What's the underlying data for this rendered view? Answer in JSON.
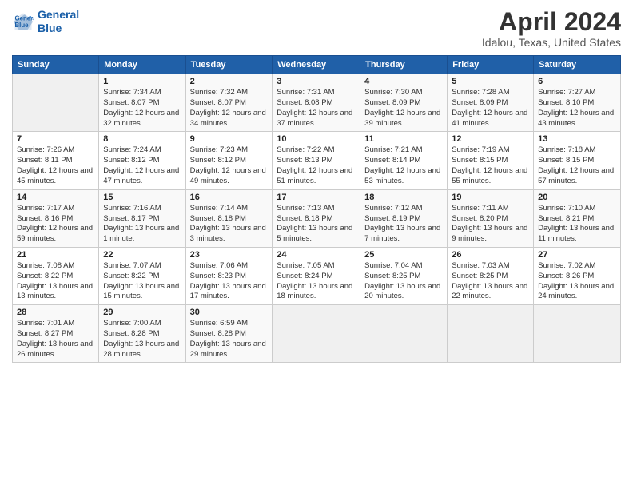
{
  "header": {
    "logo_line1": "General",
    "logo_line2": "Blue",
    "month": "April 2024",
    "location": "Idalou, Texas, United States"
  },
  "weekdays": [
    "Sunday",
    "Monday",
    "Tuesday",
    "Wednesday",
    "Thursday",
    "Friday",
    "Saturday"
  ],
  "weeks": [
    [
      {
        "day": "",
        "sunrise": "",
        "sunset": "",
        "daylight": ""
      },
      {
        "day": "1",
        "sunrise": "Sunrise: 7:34 AM",
        "sunset": "Sunset: 8:07 PM",
        "daylight": "Daylight: 12 hours and 32 minutes."
      },
      {
        "day": "2",
        "sunrise": "Sunrise: 7:32 AM",
        "sunset": "Sunset: 8:07 PM",
        "daylight": "Daylight: 12 hours and 34 minutes."
      },
      {
        "day": "3",
        "sunrise": "Sunrise: 7:31 AM",
        "sunset": "Sunset: 8:08 PM",
        "daylight": "Daylight: 12 hours and 37 minutes."
      },
      {
        "day": "4",
        "sunrise": "Sunrise: 7:30 AM",
        "sunset": "Sunset: 8:09 PM",
        "daylight": "Daylight: 12 hours and 39 minutes."
      },
      {
        "day": "5",
        "sunrise": "Sunrise: 7:28 AM",
        "sunset": "Sunset: 8:09 PM",
        "daylight": "Daylight: 12 hours and 41 minutes."
      },
      {
        "day": "6",
        "sunrise": "Sunrise: 7:27 AM",
        "sunset": "Sunset: 8:10 PM",
        "daylight": "Daylight: 12 hours and 43 minutes."
      }
    ],
    [
      {
        "day": "7",
        "sunrise": "Sunrise: 7:26 AM",
        "sunset": "Sunset: 8:11 PM",
        "daylight": "Daylight: 12 hours and 45 minutes."
      },
      {
        "day": "8",
        "sunrise": "Sunrise: 7:24 AM",
        "sunset": "Sunset: 8:12 PM",
        "daylight": "Daylight: 12 hours and 47 minutes."
      },
      {
        "day": "9",
        "sunrise": "Sunrise: 7:23 AM",
        "sunset": "Sunset: 8:12 PM",
        "daylight": "Daylight: 12 hours and 49 minutes."
      },
      {
        "day": "10",
        "sunrise": "Sunrise: 7:22 AM",
        "sunset": "Sunset: 8:13 PM",
        "daylight": "Daylight: 12 hours and 51 minutes."
      },
      {
        "day": "11",
        "sunrise": "Sunrise: 7:21 AM",
        "sunset": "Sunset: 8:14 PM",
        "daylight": "Daylight: 12 hours and 53 minutes."
      },
      {
        "day": "12",
        "sunrise": "Sunrise: 7:19 AM",
        "sunset": "Sunset: 8:15 PM",
        "daylight": "Daylight: 12 hours and 55 minutes."
      },
      {
        "day": "13",
        "sunrise": "Sunrise: 7:18 AM",
        "sunset": "Sunset: 8:15 PM",
        "daylight": "Daylight: 12 hours and 57 minutes."
      }
    ],
    [
      {
        "day": "14",
        "sunrise": "Sunrise: 7:17 AM",
        "sunset": "Sunset: 8:16 PM",
        "daylight": "Daylight: 12 hours and 59 minutes."
      },
      {
        "day": "15",
        "sunrise": "Sunrise: 7:16 AM",
        "sunset": "Sunset: 8:17 PM",
        "daylight": "Daylight: 13 hours and 1 minute."
      },
      {
        "day": "16",
        "sunrise": "Sunrise: 7:14 AM",
        "sunset": "Sunset: 8:18 PM",
        "daylight": "Daylight: 13 hours and 3 minutes."
      },
      {
        "day": "17",
        "sunrise": "Sunrise: 7:13 AM",
        "sunset": "Sunset: 8:18 PM",
        "daylight": "Daylight: 13 hours and 5 minutes."
      },
      {
        "day": "18",
        "sunrise": "Sunrise: 7:12 AM",
        "sunset": "Sunset: 8:19 PM",
        "daylight": "Daylight: 13 hours and 7 minutes."
      },
      {
        "day": "19",
        "sunrise": "Sunrise: 7:11 AM",
        "sunset": "Sunset: 8:20 PM",
        "daylight": "Daylight: 13 hours and 9 minutes."
      },
      {
        "day": "20",
        "sunrise": "Sunrise: 7:10 AM",
        "sunset": "Sunset: 8:21 PM",
        "daylight": "Daylight: 13 hours and 11 minutes."
      }
    ],
    [
      {
        "day": "21",
        "sunrise": "Sunrise: 7:08 AM",
        "sunset": "Sunset: 8:22 PM",
        "daylight": "Daylight: 13 hours and 13 minutes."
      },
      {
        "day": "22",
        "sunrise": "Sunrise: 7:07 AM",
        "sunset": "Sunset: 8:22 PM",
        "daylight": "Daylight: 13 hours and 15 minutes."
      },
      {
        "day": "23",
        "sunrise": "Sunrise: 7:06 AM",
        "sunset": "Sunset: 8:23 PM",
        "daylight": "Daylight: 13 hours and 17 minutes."
      },
      {
        "day": "24",
        "sunrise": "Sunrise: 7:05 AM",
        "sunset": "Sunset: 8:24 PM",
        "daylight": "Daylight: 13 hours and 18 minutes."
      },
      {
        "day": "25",
        "sunrise": "Sunrise: 7:04 AM",
        "sunset": "Sunset: 8:25 PM",
        "daylight": "Daylight: 13 hours and 20 minutes."
      },
      {
        "day": "26",
        "sunrise": "Sunrise: 7:03 AM",
        "sunset": "Sunset: 8:25 PM",
        "daylight": "Daylight: 13 hours and 22 minutes."
      },
      {
        "day": "27",
        "sunrise": "Sunrise: 7:02 AM",
        "sunset": "Sunset: 8:26 PM",
        "daylight": "Daylight: 13 hours and 24 minutes."
      }
    ],
    [
      {
        "day": "28",
        "sunrise": "Sunrise: 7:01 AM",
        "sunset": "Sunset: 8:27 PM",
        "daylight": "Daylight: 13 hours and 26 minutes."
      },
      {
        "day": "29",
        "sunrise": "Sunrise: 7:00 AM",
        "sunset": "Sunset: 8:28 PM",
        "daylight": "Daylight: 13 hours and 28 minutes."
      },
      {
        "day": "30",
        "sunrise": "Sunrise: 6:59 AM",
        "sunset": "Sunset: 8:28 PM",
        "daylight": "Daylight: 13 hours and 29 minutes."
      },
      {
        "day": "",
        "sunrise": "",
        "sunset": "",
        "daylight": ""
      },
      {
        "day": "",
        "sunrise": "",
        "sunset": "",
        "daylight": ""
      },
      {
        "day": "",
        "sunrise": "",
        "sunset": "",
        "daylight": ""
      },
      {
        "day": "",
        "sunrise": "",
        "sunset": "",
        "daylight": ""
      }
    ]
  ]
}
